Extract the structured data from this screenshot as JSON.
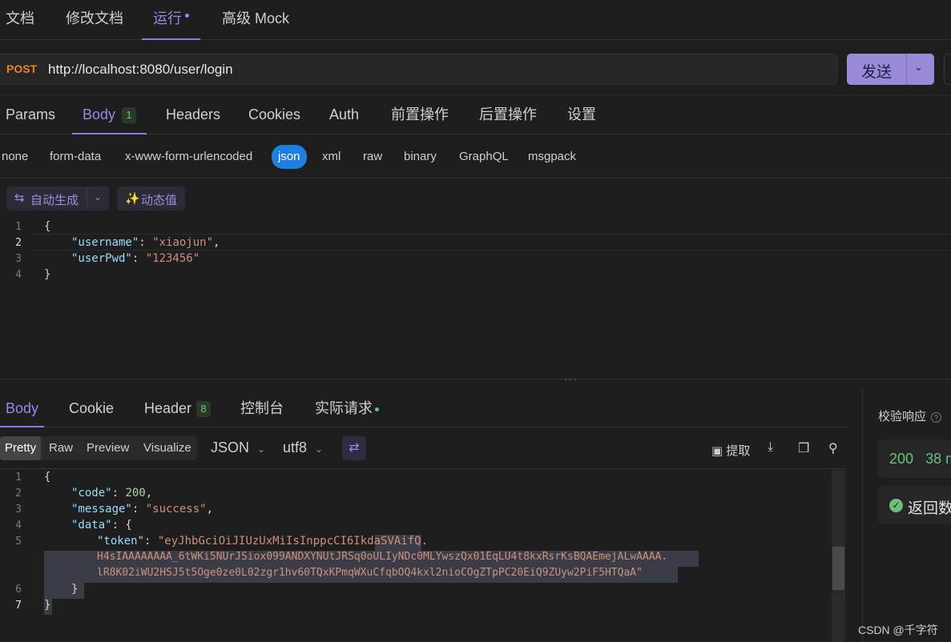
{
  "top_tabs": [
    {
      "label": "文档"
    },
    {
      "label": "修改文档"
    },
    {
      "label": "运行"
    },
    {
      "label": "高级 Mock"
    }
  ],
  "request": {
    "method": "POST",
    "url": "http://localhost:8080/user/login",
    "send_label": "发送"
  },
  "request_tabs": {
    "params": "Params",
    "body": "Body",
    "body_count": "1",
    "headers": "Headers",
    "cookies": "Cookies",
    "auth": "Auth",
    "pre": "前置操作",
    "post": "后置操作",
    "settings": "设置"
  },
  "body_types": [
    "none",
    "form-data",
    "x-www-form-urlencoded",
    "json",
    "xml",
    "raw",
    "binary",
    "GraphQL",
    "msgpack"
  ],
  "selected_body_type": "json",
  "toolbar": {
    "auto_generate": "自动生成",
    "dynamic_value": "动态值"
  },
  "request_body": {
    "line_numbers": [
      "1",
      "2",
      "3",
      "4"
    ],
    "open_brace": "{",
    "username_key": "\"username\"",
    "username_value": "\"xiaojun\"",
    "userpwd_key": "\"userPwd\"",
    "userpwd_value": "\"123456\"",
    "close_brace": "}"
  },
  "response_tabs": {
    "body": "Body",
    "cookie": "Cookie",
    "header": "Header",
    "header_count": "8",
    "console": "控制台",
    "actual_request": "实际请求"
  },
  "view_modes": [
    "Pretty",
    "Raw",
    "Preview",
    "Visualize"
  ],
  "format": "JSON",
  "encoding": "utf8",
  "extract_label": "提取",
  "response_body": {
    "line_numbers": [
      "1",
      "2",
      "3",
      "4",
      "5",
      "6",
      "7"
    ],
    "code_key": "\"code\"",
    "code_value": "200",
    "message_key": "\"message\"",
    "message_value": "\"success\"",
    "data_key": "\"data\"",
    "token_key": "\"token\"",
    "token_line1": "\"eyJhbGciOiJIUzUxMiIsInppcCI6IkdaSVAifQ.",
    "token_line2": "H4sIAAAAAAAA_6tWKi5NUrJSiox099ANDXYNUtJRSq0oULIyNDc0MLYwszQx01EqLU4t8kxRsrKsBQAEmejALwAAAA.",
    "token_line3": "lR8K02iWU2HSJ5t5Oge0ze0L02zgr1hv60TQxKPmqWXuCfqbOQ4kxl2nioCOgZTpPC20EiQ9ZUyw2PiF5HTQaA\""
  },
  "right_panel": {
    "title": "校验响应",
    "status_code": "200",
    "time": "38 m",
    "return_label": "返回数"
  },
  "watermark": "CSDN @千字符",
  "colors": {
    "accent": "#9b87e6",
    "method_post": "#e8832a",
    "json_selected": "#1f7fe0",
    "success": "#6cc07a"
  }
}
